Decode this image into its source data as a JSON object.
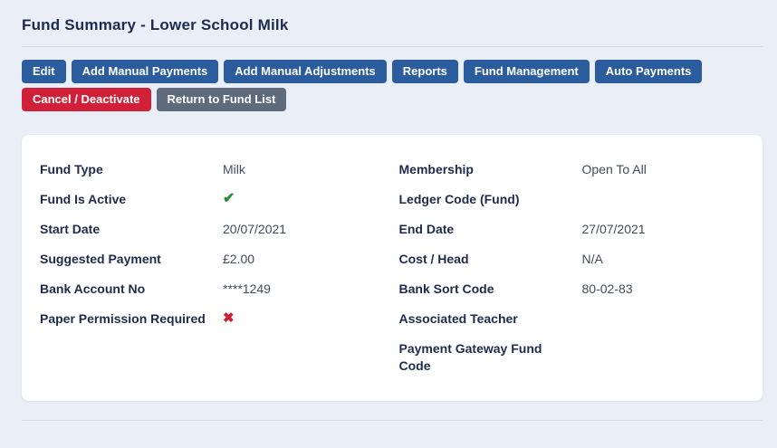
{
  "page": {
    "title": "Fund Summary - Lower School Milk"
  },
  "toolbar": {
    "buttons": [
      {
        "label": "Edit",
        "style": "primary"
      },
      {
        "label": "Add Manual Payments",
        "style": "primary"
      },
      {
        "label": "Add Manual Adjustments",
        "style": "primary"
      },
      {
        "label": "Reports",
        "style": "primary"
      },
      {
        "label": "Fund Management",
        "style": "primary"
      },
      {
        "label": "Auto Payments",
        "style": "primary"
      },
      {
        "label": "Cancel / Deactivate",
        "style": "danger"
      },
      {
        "label": "Return to Fund List",
        "style": "secondary"
      }
    ]
  },
  "fund_details": {
    "left": [
      {
        "label": "Fund Type",
        "value": "Milk"
      },
      {
        "label": "Fund Is Active",
        "value": "✔",
        "type": "check"
      },
      {
        "label": "Start Date",
        "value": "20/07/2021"
      },
      {
        "label": "Suggested Payment",
        "value": "£2.00"
      },
      {
        "label": "Bank Account No",
        "value": "****1249"
      },
      {
        "label": "Paper Permission Required",
        "value": "✖",
        "type": "cross"
      }
    ],
    "right": [
      {
        "label": "Membership",
        "value": "Open To All"
      },
      {
        "label": "Ledger Code (Fund)",
        "value": ""
      },
      {
        "label": "End Date",
        "value": "27/07/2021"
      },
      {
        "label": "Cost / Head",
        "value": "N/A"
      },
      {
        "label": "Bank Sort Code",
        "value": "80-02-83"
      },
      {
        "label": "Associated Teacher",
        "value": ""
      },
      {
        "label": "Payment Gateway Fund Code",
        "value": ""
      }
    ]
  },
  "colors": {
    "page-bg": "#eaeef6",
    "heading": "#1d2c4e",
    "value": "#3f4d5e",
    "primary": "#2b5c9e",
    "danger": "#d02139",
    "secondary": "#5f6a7d",
    "success": "#2e8b3d",
    "cross": "#cc1f2f",
    "divider": "#d4dbe8"
  }
}
